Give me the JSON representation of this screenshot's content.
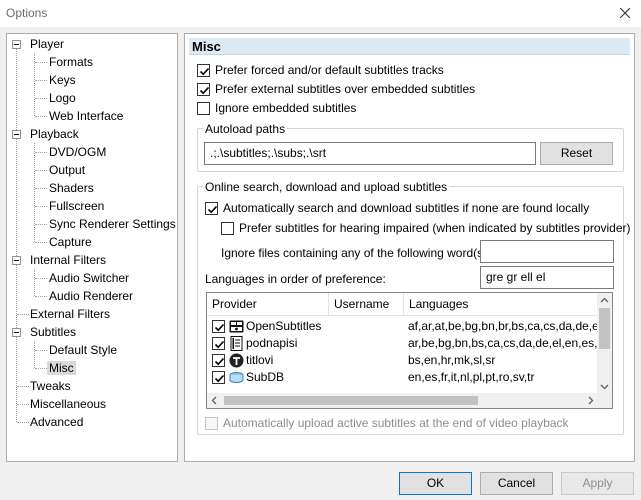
{
  "window": {
    "title": "Options"
  },
  "tree": {
    "items": [
      {
        "label": "Player"
      },
      {
        "label": "Formats"
      },
      {
        "label": "Keys"
      },
      {
        "label": "Logo"
      },
      {
        "label": "Web Interface"
      },
      {
        "label": "Playback"
      },
      {
        "label": "DVD/OGM"
      },
      {
        "label": "Output"
      },
      {
        "label": "Shaders"
      },
      {
        "label": "Fullscreen"
      },
      {
        "label": "Sync Renderer Settings"
      },
      {
        "label": "Capture"
      },
      {
        "label": "Internal Filters"
      },
      {
        "label": "Audio Switcher"
      },
      {
        "label": "Audio Renderer"
      },
      {
        "label": "External Filters"
      },
      {
        "label": "Subtitles"
      },
      {
        "label": "Default Style"
      },
      {
        "label": "Misc"
      },
      {
        "label": "Tweaks"
      },
      {
        "label": "Miscellaneous"
      },
      {
        "label": "Advanced"
      }
    ]
  },
  "panel": {
    "header": "Misc",
    "prefer_forced": {
      "label": "Prefer forced and/or default subtitles tracks",
      "checked": true
    },
    "prefer_external": {
      "label": "Prefer external subtitles over embedded subtitles",
      "checked": true
    },
    "ignore_embedded": {
      "label": "Ignore embedded subtitles",
      "checked": false
    },
    "autoload": {
      "title": "Autoload paths",
      "value": ".;.\\subtitles;.\\subs;.\\srt",
      "reset_label": "Reset"
    },
    "online": {
      "title": "Online search, download and upload subtitles",
      "auto_search": {
        "label": "Automatically search and download subtitles if none are found locally",
        "checked": true
      },
      "hearing_impaired": {
        "label": "Prefer subtitles for hearing impaired (when indicated by subtitles provider)",
        "checked": false
      },
      "ignore_words_label": "Ignore files containing any of the following word(s):",
      "ignore_words_value": "",
      "languages_label": "Languages in order of preference:",
      "languages_value": "gre gr ell el",
      "columns": {
        "provider": "Provider",
        "username": "Username",
        "languages": "Languages"
      },
      "providers": [
        {
          "name": "OpenSubtitles",
          "username": "",
          "languages": "af,ar,at,be,bg,bn,br,bs,ca,cs,da,de,e",
          "checked": true,
          "icon": "opensubtitles-icon"
        },
        {
          "name": "podnapisi",
          "username": "",
          "languages": "ar,be,bg,bn,bs,ca,cs,da,de,el,en,es,e",
          "checked": true,
          "icon": "podnapisi-icon"
        },
        {
          "name": "titlovi",
          "username": "",
          "languages": "bs,en,hr,mk,sl,sr",
          "checked": true,
          "icon": "titlovi-icon"
        },
        {
          "name": "SubDB",
          "username": "",
          "languages": "en,es,fr,it,nl,pl,pt,ro,sv,tr",
          "checked": true,
          "icon": "subdb-icon"
        }
      ],
      "auto_upload": {
        "label": "Automatically upload active subtitles at the end of video playback",
        "checked": false,
        "disabled": true
      }
    }
  },
  "buttons": {
    "ok": "OK",
    "cancel": "Cancel",
    "apply": "Apply"
  },
  "colors": {
    "header_bg": "#ddeaf4",
    "selected_bg": "#d9d9d9",
    "primary_border": "#0078d7"
  }
}
